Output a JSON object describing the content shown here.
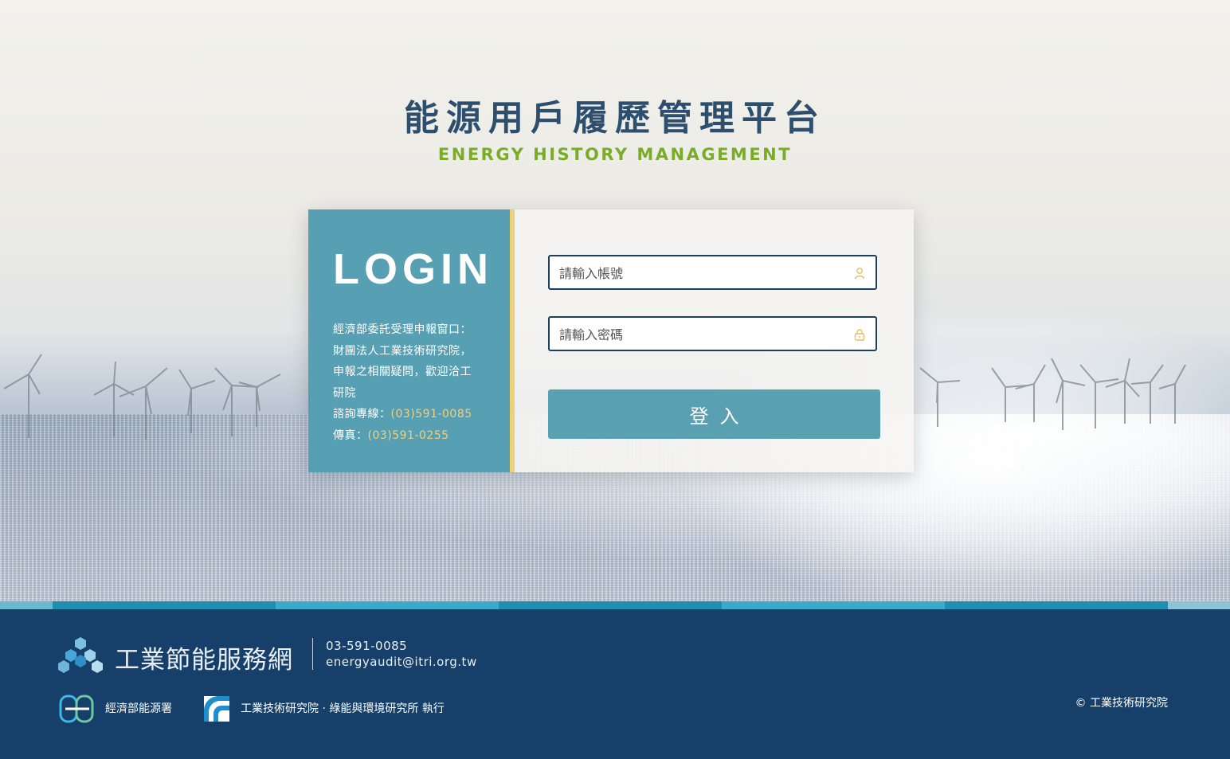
{
  "header": {
    "title": "能源用戶履歷管理平台",
    "subtitle": "ENERGY HISTORY MANAGEMENT"
  },
  "login_panel": {
    "heading": "LOGIN",
    "contact_lines": [
      "經濟部委託受理申報窗口：",
      "財團法人工業技術研究院，",
      "申報之相關疑問，歡迎洽工",
      "研院"
    ],
    "hotline_label": "諮詢專線：",
    "hotline": "(03)591-0085",
    "fax_label": "傳真：",
    "fax": "(03)591-0255"
  },
  "form": {
    "account_placeholder": "請輸入帳號",
    "password_placeholder": "請輸入密碼",
    "submit_label": "登入"
  },
  "footer": {
    "brand_name": "工業節能服務網",
    "phone": "03-591-0085",
    "email": "energyaudit@itri.org.tw",
    "moea_name": "經濟部能源署",
    "itri_name": "工業技術研究院 · 綠能與環境研究所 執行",
    "copyright": "© 工業技術研究院"
  },
  "colors": {
    "title": "#2d4f6d",
    "subtitle": "#7aac2a",
    "panel": "#579fb2",
    "accent": "#efd07a",
    "footer": "#16406a",
    "input_border": "#1e3f64"
  },
  "icons": {
    "account": "user-icon",
    "password": "lock-icon"
  }
}
